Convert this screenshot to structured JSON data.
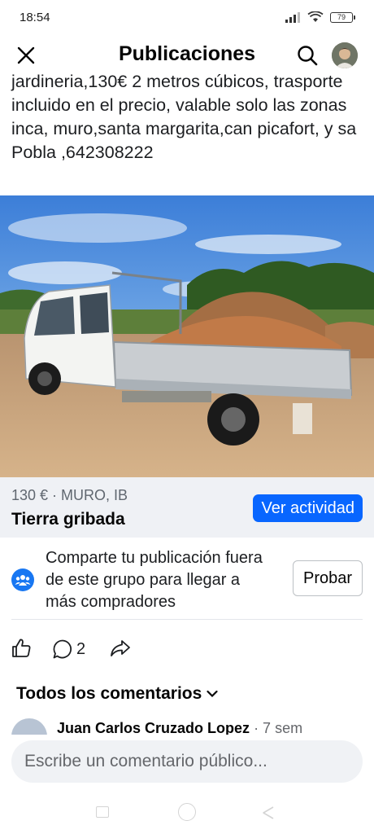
{
  "status_bar": {
    "time": "18:54",
    "battery": "79",
    "icons": [
      "signal-icon",
      "wifi-icon",
      "battery-icon"
    ]
  },
  "header": {
    "title": "Publicaciones",
    "icons": [
      "close-icon",
      "search-icon",
      "avatar"
    ]
  },
  "post": {
    "description": "jardineria,130€ 2 metros cúbicos, trasporte incluido en el precio, valable solo las zonas inca, muro,santa margarita,can picafort, y sa Pobla ,642308222"
  },
  "listing": {
    "meta": "130 € · MURO, IB",
    "title": "Tierra gribada",
    "activity_button": "Ver actividad"
  },
  "share_prompt": {
    "text": "Comparte tu publicación fuera de este grupo para llegar a más compradores",
    "button": "Probar",
    "icon": "group-icon"
  },
  "actions": {
    "comment_count": "2",
    "icons": [
      "like-icon",
      "comment-icon",
      "share-icon"
    ]
  },
  "comments": {
    "title": "Todos los comentarios",
    "first_author": "Juan Carlos Cruzado Lopez",
    "first_time": "· 7 sem"
  },
  "composer": {
    "placeholder": "Escribe un comentario público..."
  },
  "colors": {
    "accent": "#0866ff",
    "listing_bg": "#eff1f5",
    "composer_bg": "#f0f2f5"
  }
}
